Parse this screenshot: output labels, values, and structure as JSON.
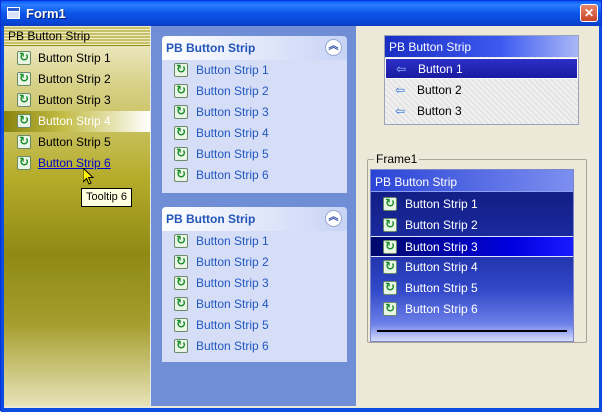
{
  "window": {
    "title": "Form1",
    "close_glyph": "✕"
  },
  "olive_strip": {
    "header": "PB Button Strip",
    "items": [
      "Button Strip 1",
      "Button Strip 2",
      "Button Strip 3",
      "Button Strip 4",
      "Button Strip 5",
      "Button Strip 6"
    ],
    "active_index": 3,
    "hover_index": 5,
    "tooltip": "Tooltip 6"
  },
  "panels": [
    {
      "title": "PB Button Strip",
      "items": [
        "Button Strip 1",
        "Button Strip 2",
        "Button Strip 3",
        "Button Strip 4",
        "Button Strip 5",
        "Button Strip 6"
      ]
    },
    {
      "title": "PB Button Strip",
      "items": [
        "Button Strip 1",
        "Button Strip 2",
        "Button Strip 3",
        "Button Strip 4",
        "Button Strip 5",
        "Button Strip 6"
      ]
    }
  ],
  "grey_strip": {
    "header": "PB Button Strip",
    "items": [
      "Button 1",
      "Button 2",
      "Button 3"
    ],
    "active_index": 0
  },
  "frame1": {
    "label": "Frame1",
    "strip": {
      "header": "PB Button Strip",
      "items": [
        "Button Strip 1",
        "Button Strip 2",
        "Button Strip 3",
        "Button Strip 4",
        "Button Strip 5",
        "Button Strip 6"
      ],
      "active_index": 2
    }
  },
  "icons": {
    "item_icon": "refresh-icon",
    "collapse": "double-chevron-up-icon",
    "arrow": "arrow-left-icon"
  },
  "colors": {
    "title_bar": "#0a54e8",
    "panel_text": "#2158c0",
    "nav_active": "#0000e0",
    "olive": "#8f8a14"
  }
}
